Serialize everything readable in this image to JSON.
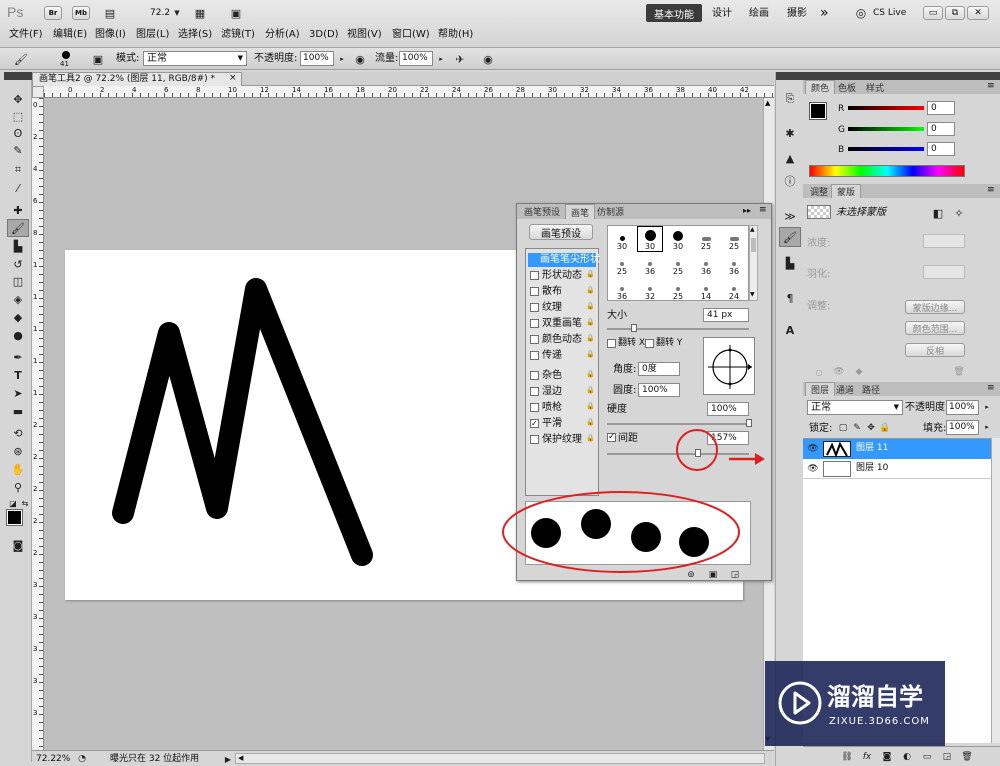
{
  "menu_bar": {
    "app_logo": "Ps",
    "zoom": "72.2",
    "workspaces": [
      "基本功能",
      "设计",
      "绘画",
      "摄影"
    ],
    "more": "»",
    "cs_live": "CS Live"
  },
  "menus": [
    "文件(F)",
    "编辑(E)",
    "图像(I)",
    "图层(L)",
    "选择(S)",
    "滤镜(T)",
    "分析(A)",
    "3D(D)",
    "视图(V)",
    "窗口(W)",
    "帮助(H)"
  ],
  "options_bar": {
    "brush_size": "41",
    "mode_label": "模式:",
    "mode_value": "正常",
    "opacity_label": "不透明度:",
    "opacity_value": "100%",
    "flow_label": "流量:",
    "flow_value": "100%"
  },
  "document": {
    "tab_title": "画笔工具2 @ 72.2% (图层 11, RGB/8#) *",
    "ruler_labels": [
      "0",
      "2",
      "4",
      "6",
      "8",
      "10",
      "12",
      "14",
      "16",
      "18",
      "20",
      "22",
      "24",
      "26",
      "28",
      "30",
      "32",
      "34",
      "36",
      "38",
      "40",
      "42"
    ],
    "vruler_labels": [
      "0",
      "2",
      "4",
      "6",
      "8",
      "1",
      "1",
      "1",
      "1",
      "1",
      "2",
      "2",
      "2",
      "2",
      "2",
      "3",
      "3",
      "3",
      "3",
      "3"
    ]
  },
  "status_bar": {
    "zoom": "72.22%",
    "message": "曝光只在 32 位起作用"
  },
  "brush_panel": {
    "tabs": [
      "画笔预设",
      "画笔",
      "仿制源"
    ],
    "preset_button": "画笔预设",
    "options": [
      {
        "label": "画笔笔尖形状",
        "checkbox": false,
        "lock": false,
        "selected": true
      },
      {
        "label": "形状动态",
        "checkbox": true,
        "checked": false,
        "lock": true
      },
      {
        "label": "散布",
        "checkbox": true,
        "checked": false,
        "lock": true
      },
      {
        "label": "纹理",
        "checkbox": true,
        "checked": false,
        "lock": true
      },
      {
        "label": "双重画笔",
        "checkbox": true,
        "checked": false,
        "lock": true
      },
      {
        "label": "颜色动态",
        "checkbox": true,
        "checked": false,
        "lock": true
      },
      {
        "label": "传递",
        "checkbox": true,
        "checked": false,
        "lock": true
      },
      {
        "label": "杂色",
        "checkbox": true,
        "checked": false,
        "lock": true
      },
      {
        "label": "湿边",
        "checkbox": true,
        "checked": false,
        "lock": true
      },
      {
        "label": "喷枪",
        "checkbox": true,
        "checked": false,
        "lock": true
      },
      {
        "label": "平滑",
        "checkbox": true,
        "checked": true,
        "lock": true
      },
      {
        "label": "保护纹理",
        "checkbox": true,
        "checked": false,
        "lock": true
      }
    ],
    "brush_tips": [
      [
        "30",
        "30",
        "30",
        "25",
        "25"
      ],
      [
        "25",
        "36",
        "25",
        "36",
        "36"
      ],
      [
        "36",
        "32",
        "25",
        "14",
        "24"
      ]
    ],
    "size_label": "大小",
    "size_value": "41 px",
    "flip_x": "翻转 X",
    "flip_y": "翻转 Y",
    "angle_label": "角度:",
    "angle_value": "0度",
    "roundness_label": "圆度:",
    "roundness_value": "100%",
    "hardness_label": "硬度",
    "hardness_value": "100%",
    "spacing_label": "间距",
    "spacing_value": "157%",
    "spacing_checked": true
  },
  "color_panel": {
    "tabs": [
      "颜色",
      "色板",
      "样式"
    ],
    "channels": [
      {
        "label": "R",
        "value": "0"
      },
      {
        "label": "G",
        "value": "0"
      },
      {
        "label": "B",
        "value": "0"
      }
    ]
  },
  "adjust_panel": {
    "tabs": [
      "调整",
      "蒙版"
    ],
    "title": "未选择蒙版",
    "density_label": "浓度:",
    "feather_label": "羽化:",
    "refine_label": "调整:",
    "buttons": [
      "蒙版边缘...",
      "颜色范围...",
      "反相"
    ]
  },
  "layers_panel": {
    "tabs": [
      "图层",
      "通道",
      "路径"
    ],
    "blend_mode": "正常",
    "opacity_label": "不透明度:",
    "opacity_value": "100%",
    "lock_label": "锁定:",
    "fill_label": "填充:",
    "fill_value": "100%",
    "layers": [
      {
        "name": "图层 11",
        "selected": true
      },
      {
        "name": "图层 10",
        "selected": false
      }
    ]
  },
  "watermark": {
    "title": "溜溜自学",
    "subtitle": "ZIXUE.3D66.COM"
  },
  "colors": {
    "app_bg": "#d6d6d6",
    "canvas_area": "#bfbfbf",
    "selection": "#3399ff",
    "annotation": "#e02020"
  }
}
